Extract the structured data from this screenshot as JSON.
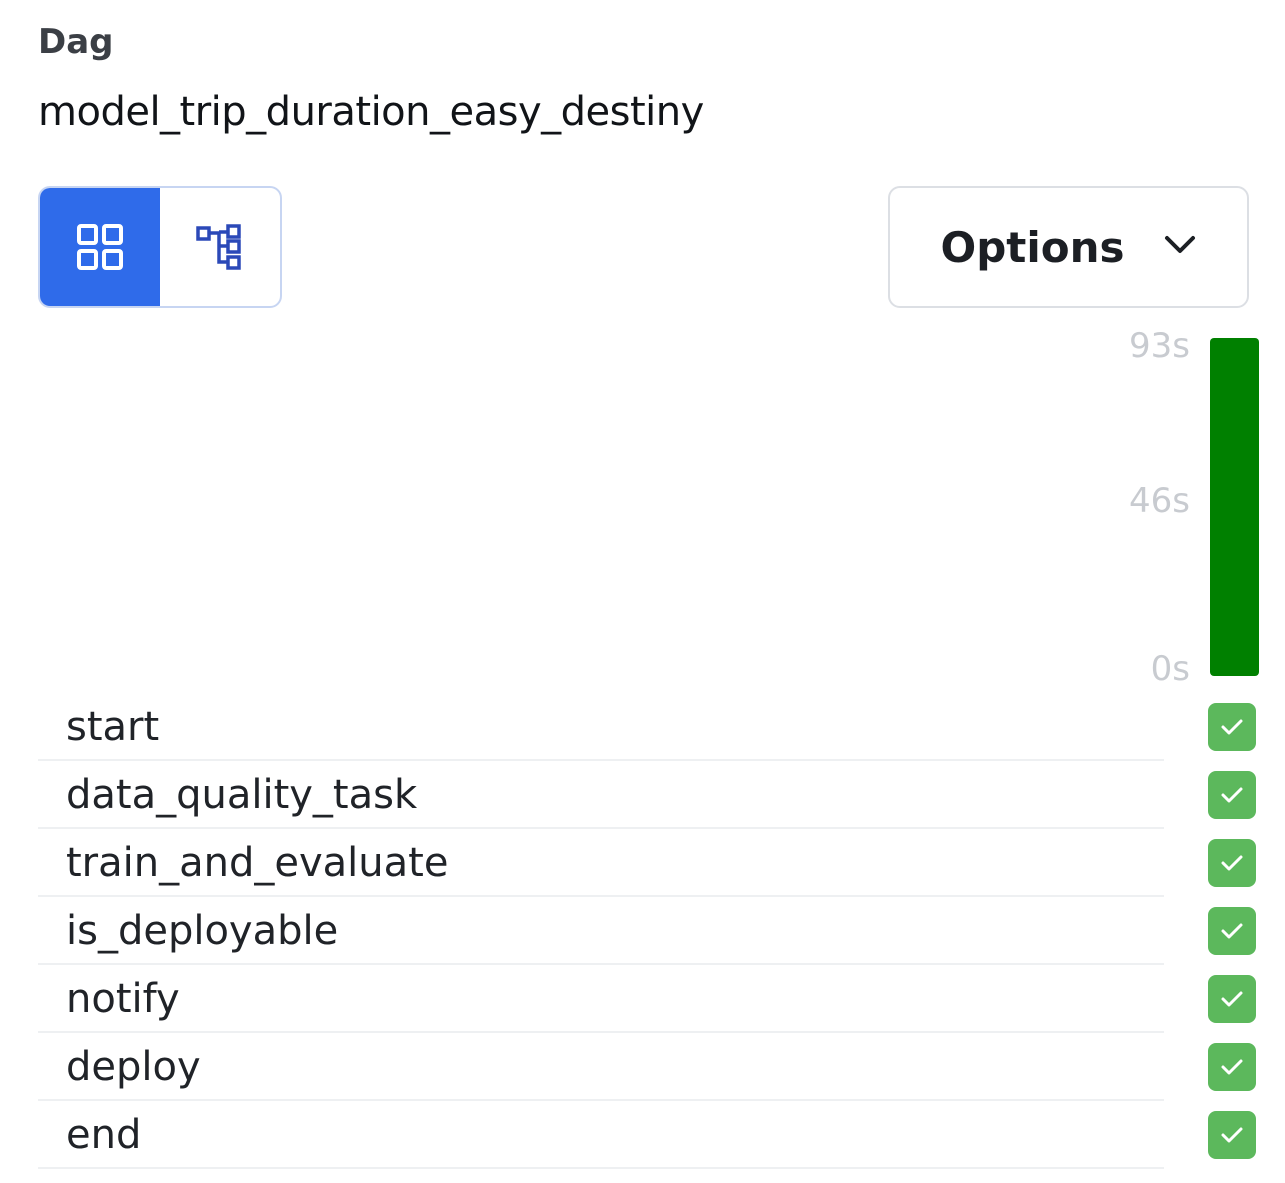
{
  "header": {
    "label": "Dag",
    "dag_id": "model_trip_duration_easy_destiny"
  },
  "view_toggle": {
    "grid_icon": "grid-view-icon",
    "graph_icon": "graph-view-icon",
    "active": "grid"
  },
  "options": {
    "label": "Options",
    "icon": "chevron-down-icon"
  },
  "duration_axis": {
    "max_label": "93s",
    "mid_label": "46s",
    "min_label": "0s"
  },
  "run": {
    "duration_fraction": 1.0,
    "status": "success",
    "color": "#008000"
  },
  "tasks": [
    {
      "name": "start",
      "status": "success"
    },
    {
      "name": "data_quality_task",
      "status": "success"
    },
    {
      "name": "train_and_evaluate",
      "status": "success"
    },
    {
      "name": "is_deployable",
      "status": "success"
    },
    {
      "name": "notify",
      "status": "success"
    },
    {
      "name": "deploy",
      "status": "success"
    },
    {
      "name": "end",
      "status": "success"
    }
  ],
  "colors": {
    "accent": "#2f6bea",
    "success_bar": "#008000",
    "success_badge": "#5cb85c"
  }
}
